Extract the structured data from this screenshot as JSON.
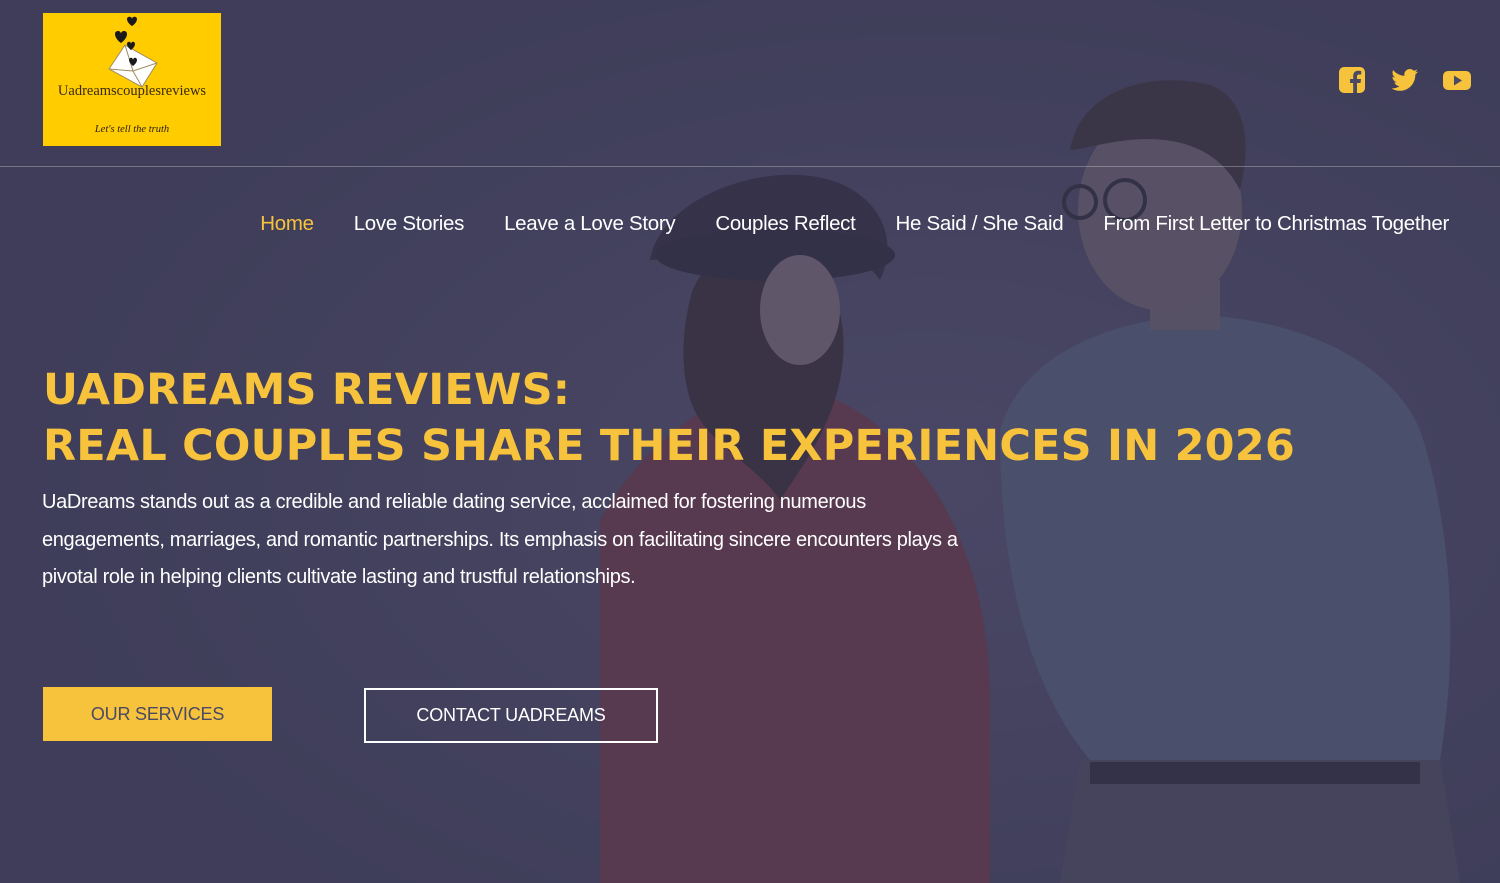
{
  "brand": {
    "name": "Uadreamscouplesreviews",
    "tagline": "Let's tell the truth",
    "logo_bg": "#ffcc00"
  },
  "social": [
    {
      "icon": "facebook-icon"
    },
    {
      "icon": "twitter-icon"
    },
    {
      "icon": "youtube-icon"
    }
  ],
  "nav": {
    "items": [
      {
        "label": "Home",
        "active": true
      },
      {
        "label": "Love Stories"
      },
      {
        "label": "Leave a Love Story"
      },
      {
        "label": "Couples Reflect"
      },
      {
        "label": "He Said / She Said"
      },
      {
        "label": "From First Letter to Christmas Together"
      }
    ]
  },
  "hero": {
    "headline_line1": "UADREAMS REVIEWS:",
    "headline_line2": "REAL COUPLES SHARE THEIR EXPERIENCES IN 2026",
    "intro": "UaDreams stands out as a credible and reliable dating service, acclaimed for fostering numerous engagements, marriages, and romantic partnerships. Its emphasis on facilitating sincere encounters plays a pivotal role in helping clients cultivate lasting and trustful relationships.",
    "primary_button": "OUR SERVICES",
    "secondary_button": "CONTACT UADREAMS"
  },
  "colors": {
    "accent": "#f7c23c",
    "background": "#4b4a63",
    "text": "#ffffff"
  }
}
